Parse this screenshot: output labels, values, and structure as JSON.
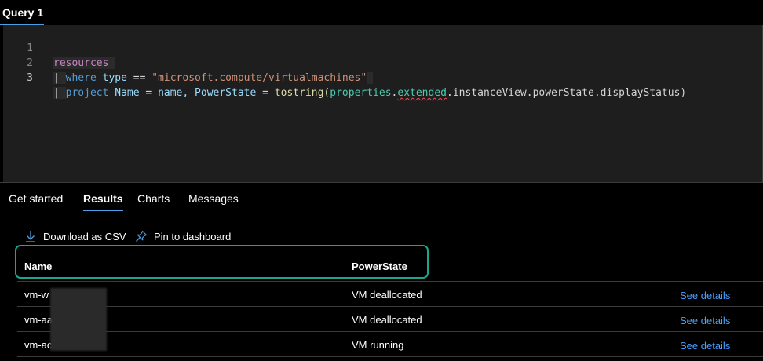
{
  "query_tabs": [
    {
      "label": "Query 1"
    }
  ],
  "editor": {
    "lines": [
      {
        "number": "1",
        "tokens": [
          "resources"
        ]
      },
      {
        "number": "2",
        "tokens": [
          "|",
          "where",
          "type",
          "==",
          "\"microsoft.compute/virtualmachines\""
        ]
      },
      {
        "number": "3",
        "tokens": [
          "|",
          "project",
          "Name",
          "=",
          "name,",
          "PowerState",
          "=",
          "tostring(",
          "properties",
          ".",
          "extended",
          ".instanceView.powerState.displayStatus)"
        ]
      }
    ]
  },
  "result_tabs": [
    {
      "label": "Get started"
    },
    {
      "label": "Results"
    },
    {
      "label": "Charts"
    },
    {
      "label": "Messages"
    }
  ],
  "toolbar": {
    "download_label": "Download as CSV",
    "pin_label": "Pin to dashboard"
  },
  "table": {
    "columns": [
      "Name",
      "PowerState"
    ],
    "rows": [
      {
        "name": "vm-w",
        "power_state": "VM deallocated",
        "link": "See details"
      },
      {
        "name": "vm-aa",
        "power_state": "VM deallocated",
        "link": "See details"
      },
      {
        "name": "vm-ac",
        "power_state": "VM running",
        "link": "See details"
      }
    ]
  },
  "colors": {
    "accent": "#4aa0e6",
    "highlight_border": "#1aa58c",
    "link": "#4aa0ff"
  }
}
